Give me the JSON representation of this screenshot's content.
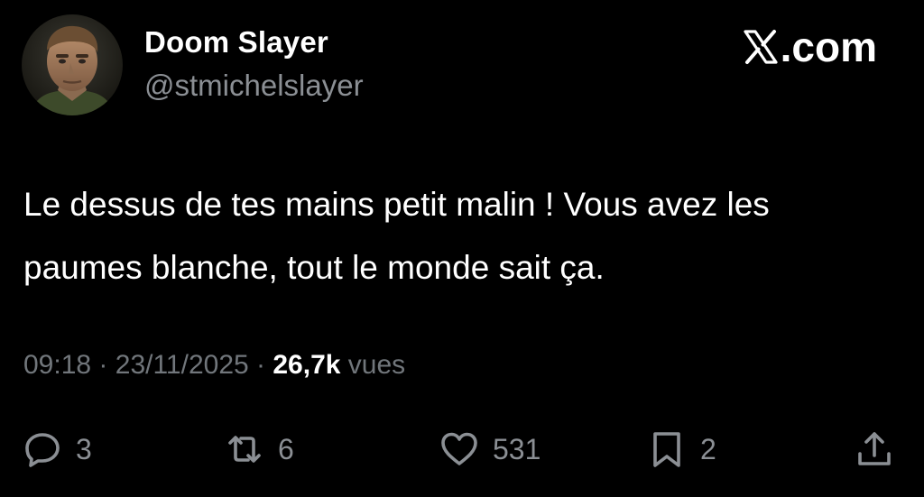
{
  "author": {
    "display_name": "Doom Slayer",
    "handle": "@stmichelslayer",
    "avatar_icon": "doom-slayer-portrait"
  },
  "brand": {
    "label": ".com",
    "logo_icon": "x-logo-icon"
  },
  "tweet": {
    "text": "Le dessus de tes mains petit malin ! Vous avez les paumes blanche, tout le monde sait ça.",
    "time": "09:18",
    "separator": "·",
    "date": "23/11/2025",
    "views_count": "26,7k",
    "views_label": "vues"
  },
  "actions": {
    "reply_count": "3",
    "retweet_count": "6",
    "like_count": "531",
    "bookmark_count": "2"
  },
  "colors": {
    "background": "#000000",
    "primary_text": "#ffffff",
    "secondary_text": "#71767b",
    "icon": "#8b8f94"
  }
}
